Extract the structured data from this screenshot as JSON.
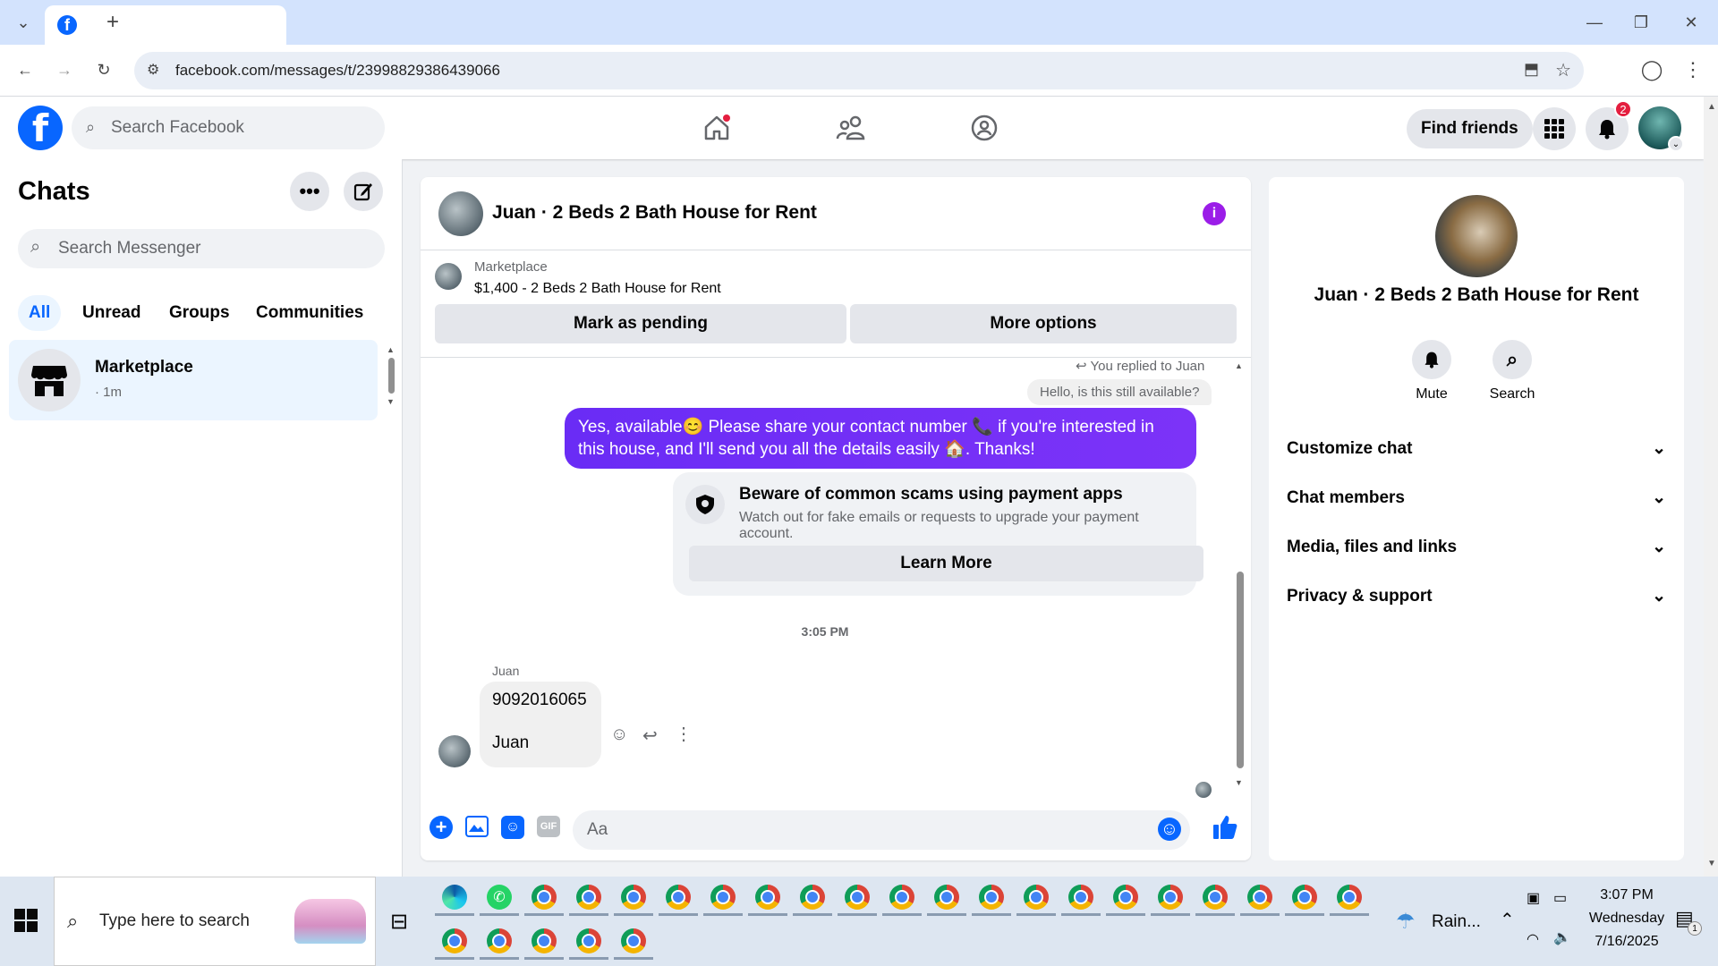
{
  "browser": {
    "url": "facebook.com/messages/t/23998829386439066"
  },
  "header": {
    "search_placeholder": "Search Facebook",
    "find_friends": "Find friends",
    "notifications_count": "2"
  },
  "left": {
    "title": "Chats",
    "search_placeholder": "Search Messenger",
    "filters": [
      "All",
      "Unread",
      "Groups",
      "Communities"
    ],
    "chat_item": {
      "name": "Marketplace",
      "meta": "· 1m"
    }
  },
  "chat": {
    "title": "Juan · 2 Beds 2 Bath House for Rent",
    "marketplace_label": "Marketplace",
    "listing": "$1,400 - 2 Beds 2 Bath House for Rent",
    "mark_pending": "Mark as pending",
    "more_options": "More options",
    "replied_to": "You replied to Juan",
    "quoted": "Hello, is this still available?",
    "my_message": "Yes, available😊 Please share your contact number 📞 if you're interested in this house, and I'll send you all the details easily 🏠. Thanks!",
    "warning_title": "Beware of common scams using payment apps",
    "warning_text": "Watch out for fake emails or requests to upgrade your payment account.",
    "learn_more": "Learn More",
    "timestamp": "3:05 PM",
    "sender": "Juan",
    "their_message_line1": "9092016065",
    "their_message_line2": "Juan",
    "composer_placeholder": "Aa"
  },
  "right": {
    "name": "Juan · 2 Beds 2 Bath House for Rent",
    "mute": "Mute",
    "search": "Search",
    "sections": [
      "Customize chat",
      "Chat members",
      "Media, files and links",
      "Privacy & support"
    ]
  },
  "taskbar": {
    "search_placeholder": "Type here to search",
    "weather": "Rain...",
    "time": "3:07 PM",
    "day": "Wednesday",
    "date": "7/16/2025",
    "notif": "1"
  }
}
